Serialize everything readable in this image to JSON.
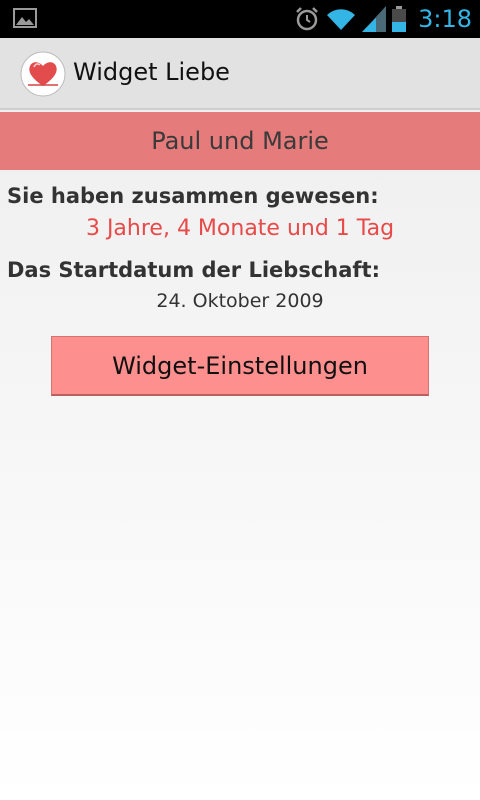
{
  "status_bar": {
    "time": "3:18",
    "icons": [
      "gallery-notification-icon",
      "alarm-icon",
      "wifi-icon",
      "signal-icon",
      "battery-icon"
    ]
  },
  "action_bar": {
    "app_title": "Widget Liebe",
    "icon": "heart-icon"
  },
  "names_banner": {
    "text": "Paul und Marie",
    "background": "#e57b7b"
  },
  "together": {
    "label": "Sie haben zusammen gewesen:",
    "value": "3 Jahre, 4 Monate und 1 Tag",
    "value_color": "#e84a4a"
  },
  "start_date": {
    "label": "Das Startdatum der Liebschaft:",
    "value": "24. Oktober 2009"
  },
  "settings_button": {
    "label": "Widget-Einstellungen",
    "background": "#fe8f8f"
  }
}
